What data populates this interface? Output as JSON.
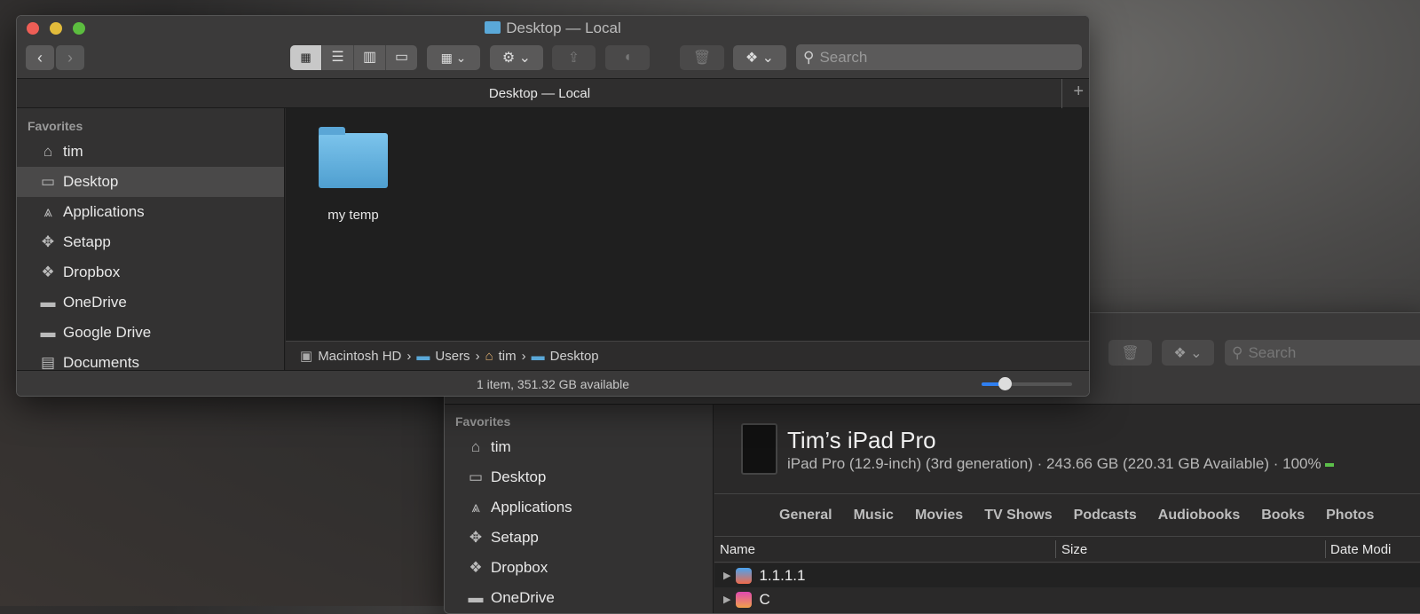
{
  "front": {
    "title": "Desktop — Local",
    "tab_title": "Desktop — Local",
    "search_placeholder": "Search",
    "sidebar": {
      "heading": "Favorites",
      "items": [
        {
          "label": "tim",
          "icon": "home-icon"
        },
        {
          "label": "Desktop",
          "icon": "desktop-icon",
          "selected": true
        },
        {
          "label": "Applications",
          "icon": "applications-icon"
        },
        {
          "label": "Setapp",
          "icon": "setapp-icon"
        },
        {
          "label": "Dropbox",
          "icon": "dropbox-icon"
        },
        {
          "label": "OneDrive",
          "icon": "folder-icon"
        },
        {
          "label": "Google Drive",
          "icon": "folder-icon"
        },
        {
          "label": "Documents",
          "icon": "documents-icon"
        }
      ]
    },
    "files": [
      {
        "name": "my temp",
        "icon": "folder-icon"
      }
    ],
    "path": [
      "Macintosh HD",
      "Users",
      "tim",
      "Desktop"
    ],
    "status": "1 item, 351.32 GB available",
    "icon_size_slider": 0.25
  },
  "back": {
    "search_placeholder": "Search",
    "sidebar": {
      "heading": "Favorites",
      "items": [
        {
          "label": "tim"
        },
        {
          "label": "Desktop"
        },
        {
          "label": "Applications"
        },
        {
          "label": "Setapp"
        },
        {
          "label": "Dropbox"
        },
        {
          "label": "OneDrive"
        }
      ]
    },
    "device": {
      "name": "Tim’s iPad Pro",
      "details": "iPad Pro (12.9-inch) (3rd generation) · 243.66 GB (220.31 GB Available) · 100%",
      "battery_color": "#5cbf4a"
    },
    "tabs": [
      "General",
      "Music",
      "Movies",
      "TV Shows",
      "Podcasts",
      "Audiobooks",
      "Books",
      "Photos"
    ],
    "columns": [
      "Name",
      "Size",
      "Date Modi"
    ],
    "rows": [
      {
        "name": "1.1.1.1"
      },
      {
        "name": "C"
      }
    ]
  }
}
